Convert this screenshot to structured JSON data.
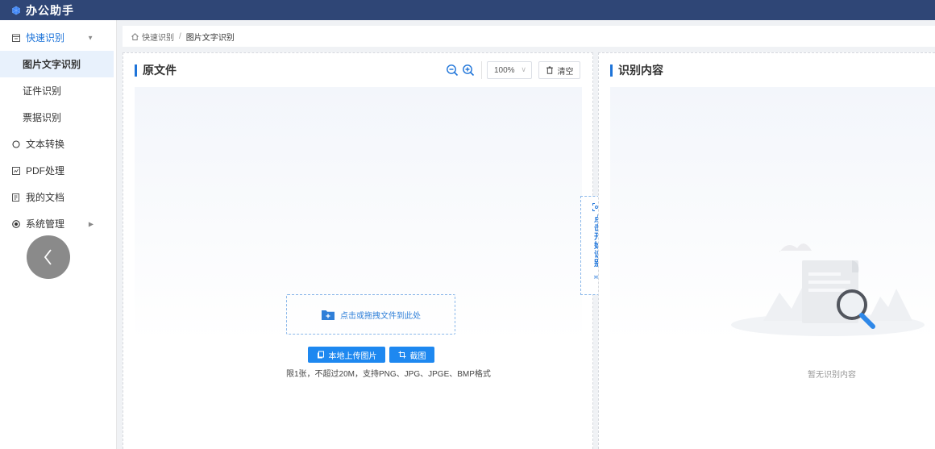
{
  "app": {
    "title": "办公助手"
  },
  "sidebar": {
    "items": [
      {
        "label": "快速识别",
        "icon": "calendar-icon",
        "expanded": true,
        "children": [
          {
            "label": "图片文字识别",
            "active": true
          },
          {
            "label": "证件识别"
          },
          {
            "label": "票据识别"
          }
        ]
      },
      {
        "label": "文本转换",
        "icon": "circle-icon"
      },
      {
        "label": "PDF处理",
        "icon": "pdf-file-icon"
      },
      {
        "label": "我的文档",
        "icon": "document-icon"
      },
      {
        "label": "系统管理",
        "icon": "settings-dot-icon",
        "has_submenu": true
      }
    ]
  },
  "breadcrumb": {
    "home": "快速识别",
    "current": "图片文字识别"
  },
  "source_panel": {
    "title": "原文件",
    "zoom": "100%",
    "clear_label": "清空",
    "dropzone_text": "点击或拖拽文件到此处",
    "upload_label": "本地上传图片",
    "screenshot_label": "截图",
    "hint": "限1张，不超过20M，支持PNG、JPG、JPGE、BMP格式"
  },
  "start_button": {
    "label": "点击开始识别",
    "chevrons": "›››"
  },
  "result_panel": {
    "title": "识别内容",
    "empty_text": "暂无识别内容"
  },
  "colors": {
    "primary": "#1e88f0",
    "topbar": "#2f4676",
    "active_bg": "#e8f1fc"
  }
}
